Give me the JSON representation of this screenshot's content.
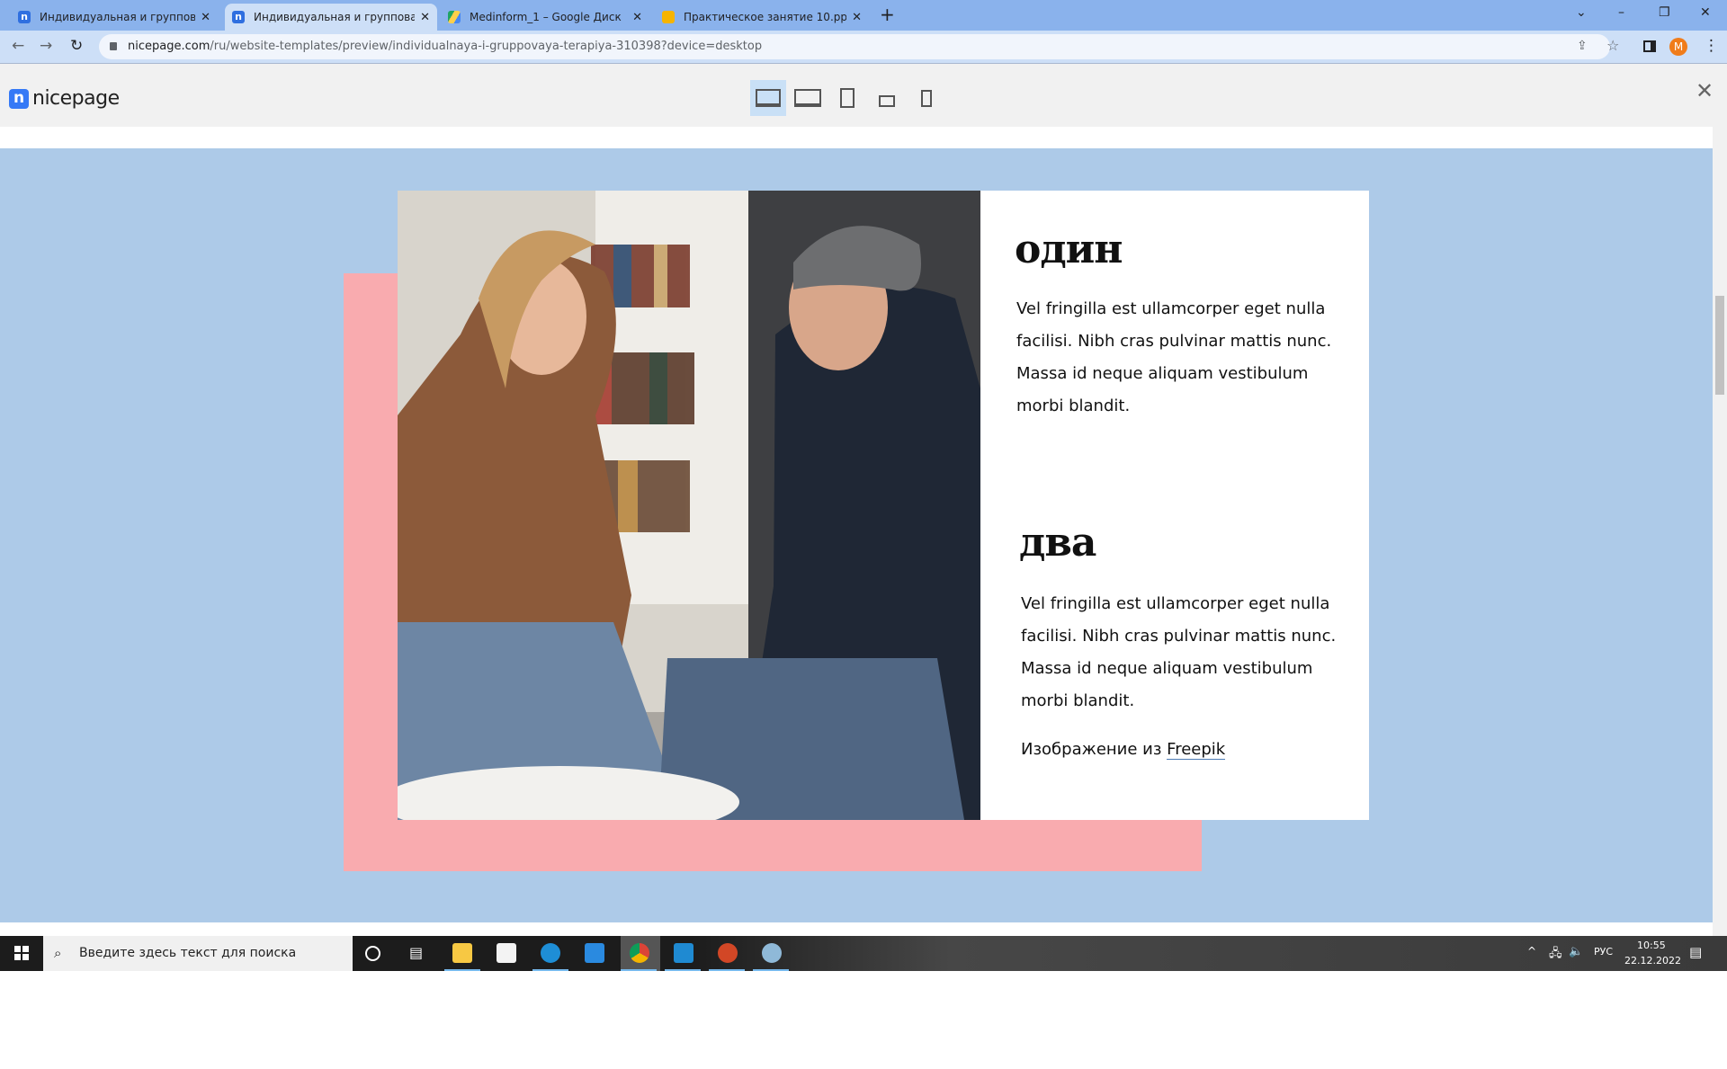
{
  "browser": {
    "tabs": [
      {
        "title": "Индивидуальная и групповая те",
        "icon": "nicepage-icon",
        "active": false
      },
      {
        "title": "Индивидуальная и групповая те",
        "icon": "nicepage-icon",
        "active": true
      },
      {
        "title": "Medinform_1 – Google Диск",
        "icon": "google-drive-icon",
        "active": false
      },
      {
        "title": "Практическое занятие 10.pptx -",
        "icon": "google-slides-icon",
        "active": false
      }
    ],
    "new_tab": "+",
    "url_host": "nicepage.com",
    "url_path": "/ru/website-templates/preview/individualnaya-i-gruppovaya-terapiya-310398?device=desktop",
    "profile_initial": "M"
  },
  "nicepage": {
    "logo": "nicepage",
    "devices": [
      "desktop",
      "laptop",
      "tablet",
      "phone-landscape",
      "phone"
    ],
    "active_device": "desktop"
  },
  "content": {
    "heading1": "один",
    "text1": "Vel fringilla est ullamcorper eget nulla facilisi. Nibh cras pulvinar mattis nunc. Massa id neque aliquam vestibulum morbi blandit.",
    "heading2": "два",
    "text2": "Vel fringilla est ullamcorper eget nulla facilisi. Nibh cras pulvinar mattis nunc. Massa id neque aliquam vestibulum morbi blandit.",
    "credit_prefix": "Изображение из",
    "credit_link": "Freepik"
  },
  "colors": {
    "page_bg": "#adcae8",
    "pink": "#f9abaf",
    "tabbar": "#8ab2ec"
  },
  "taskbar": {
    "search_placeholder": "Введите здесь текст для поиска",
    "lang": "РУС",
    "time": "10:55",
    "date": "22.12.2022"
  }
}
